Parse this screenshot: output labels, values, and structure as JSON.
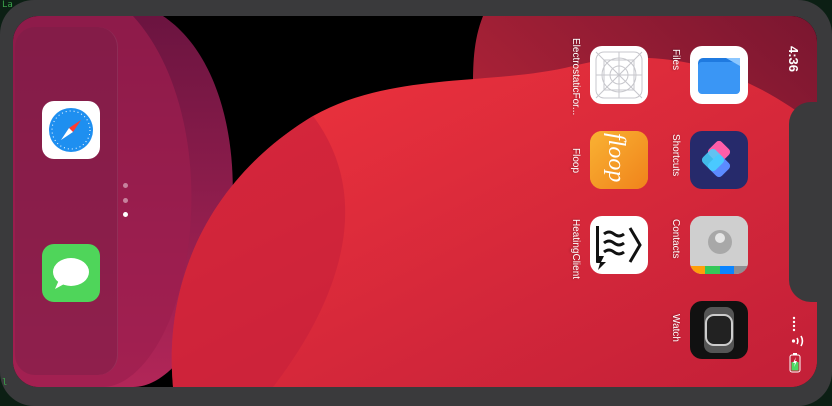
{
  "background_code": {
    "line_top": "La",
    "line_bottom": "l"
  },
  "status_bar": {
    "time": "4:36"
  },
  "page_dots": {
    "count": 3,
    "active_index": 2
  },
  "dock": [
    {
      "name": "Safari",
      "icon": "compass-icon"
    },
    {
      "name": "Messages",
      "icon": "speech-bubble-icon"
    }
  ],
  "apps": [
    {
      "label": "Files",
      "icon": "folder-icon"
    },
    {
      "label": "Shortcuts",
      "icon": "shortcuts-icon"
    },
    {
      "label": "Contacts",
      "icon": "contacts-icon"
    },
    {
      "label": "Watch",
      "icon": "watch-icon"
    },
    {
      "label": "ElectrostaticFor...",
      "icon": "placeholder-grid-icon"
    },
    {
      "label": "Floop",
      "icon": "floop-icon"
    },
    {
      "label": "HeatingClient",
      "icon": "heating-icon"
    }
  ],
  "app_icon_texts": {
    "floop": "floop"
  },
  "colors": {
    "wallpaper_red": "#e8323b",
    "wallpaper_magenta": "#b8205a",
    "bezel": "#3a3a3c"
  }
}
